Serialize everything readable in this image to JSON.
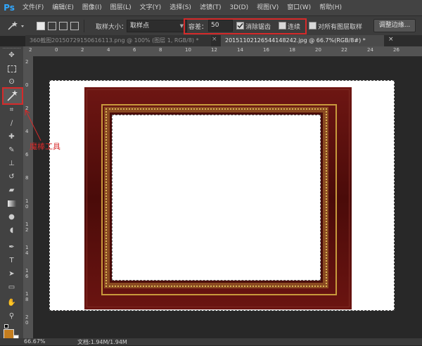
{
  "app": {
    "logo": "Ps"
  },
  "menu": [
    "文件(F)",
    "编辑(E)",
    "图像(I)",
    "图层(L)",
    "文字(Y)",
    "选择(S)",
    "滤镜(T)",
    "3D(D)",
    "视图(V)",
    "窗口(W)",
    "帮助(H)"
  ],
  "options": {
    "sample_size_label": "取样大小：",
    "sample_size_value": "取样点",
    "tolerance_label": "容差：",
    "tolerance_value": "50",
    "antialias_label": "消除锯齿",
    "antialias_checked": true,
    "contiguous_label": "连续",
    "contiguous_checked": false,
    "all_layers_label": "对所有图层取样",
    "refine_edge_label": "调整边缘..."
  },
  "tabs": [
    {
      "label": "360截图20150729150616113.png @ 100% (图层 1, RGB/8) *",
      "close": "×",
      "active": false
    },
    {
      "label": "20151102126544148242.jpg @ 66.7%(RGB/8#) *",
      "close": "×",
      "active": true
    }
  ],
  "ruler": {
    "h_ticks": [
      "2",
      "0",
      "2",
      "4",
      "6",
      "8",
      "10",
      "12",
      "14",
      "16",
      "18",
      "20",
      "22",
      "24",
      "26"
    ],
    "v_ticks": [
      "2",
      "0",
      "2",
      "4",
      "6",
      "8",
      "1 0",
      "1 2",
      "1 4",
      "1 6",
      "1 8",
      "2 0"
    ]
  },
  "annotation": {
    "label": "魔棒工具",
    "color": "#d62a2a"
  },
  "status": {
    "zoom": "66.67%",
    "doc": "文档:1.94M/1.94M"
  },
  "colors": {
    "foreground": "#c47d1e",
    "background": "#ffffff",
    "accent": "#31a8ff",
    "frame": "#5a0e0c",
    "gold": "#c89a3c"
  }
}
